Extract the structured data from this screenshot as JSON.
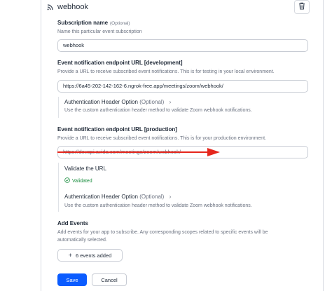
{
  "header": {
    "title": "webhook",
    "icon": "rss-icon",
    "delete_icon": "trash-icon"
  },
  "subscription_name": {
    "label": "Subscription name",
    "optional": "(Optional)",
    "help": "Name this particular event subscription",
    "value": "webhook"
  },
  "dev_endpoint": {
    "label": "Event notification endpoint URL [development]",
    "help": "Provide a URL to receive subscribed event notifications. This is for testing in your local environment.",
    "value": "https://6a45-202-142-162-6.ngrok-free.app/meetings/zoom/webhook/",
    "auth": {
      "title": "Authentication Header Option",
      "optional": "(Optional)",
      "chevron": "›",
      "help": "Use the custom authentication header method to validate Zoom webhook notifications."
    }
  },
  "prod_endpoint": {
    "label": "Event notification endpoint URL [production]",
    "help": "Provide a URL to receive subscribed event notifications. This is for your production environment.",
    "value": "https://devapi.avida.com/meetings/zoom/webhook/",
    "validate": {
      "title": "Validate the URL",
      "status": "Validated",
      "status_color": "#1a8d3e"
    },
    "auth": {
      "title": "Authentication Header Option",
      "optional": "(Optional)",
      "chevron": "›",
      "help": "Use the custom authentication header method to validate Zoom webhook notifications."
    }
  },
  "events": {
    "label": "Add Events",
    "help_line1": "Add events for your app to subscribe. Any corresponding scopes related to specific events will be",
    "help_line2": "automatically selected.",
    "button_label": "6 events added"
  },
  "actions": {
    "save_label": "Save",
    "cancel_label": "Cancel"
  },
  "colors": {
    "accent": "#0b5cff",
    "annotation_arrow": "#e5261c",
    "success": "#1a8d3e"
  }
}
